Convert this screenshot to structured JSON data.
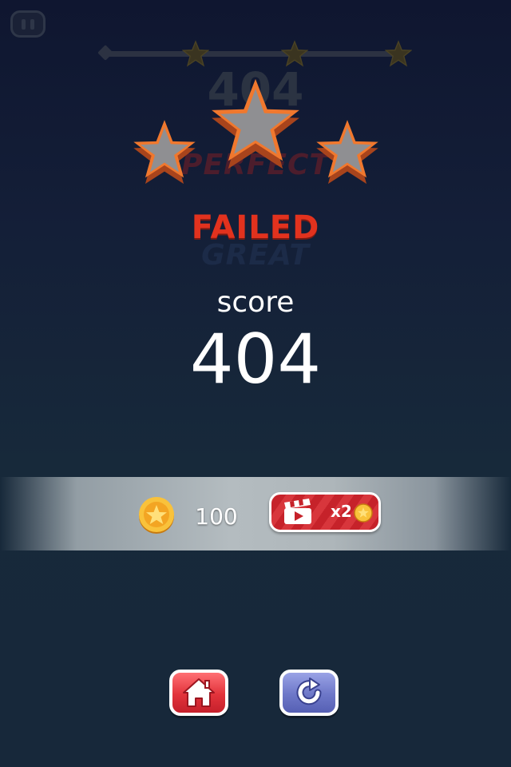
{
  "level_progress": {
    "star_count": 3
  },
  "ghost_texts": {
    "score": "404",
    "perfect": "PERFECT",
    "great": "GREAT"
  },
  "result": {
    "status": "FAILED",
    "score_label": "score",
    "score_value": "404",
    "stars_earned": 0,
    "stars_total": 3
  },
  "reward": {
    "coin_amount": "100",
    "video_multiplier": "x2"
  },
  "icons": {
    "pause": "pause-icon",
    "coin": "coin-icon",
    "video": "clapperboard-icon",
    "home": "home-icon",
    "restart": "restart-icon"
  },
  "colors": {
    "failed": "#e2321e",
    "home_button": "#e2333b",
    "restart_button": "#6d77c8",
    "video_button": "#c6222a",
    "coin": "#f7b52a"
  }
}
